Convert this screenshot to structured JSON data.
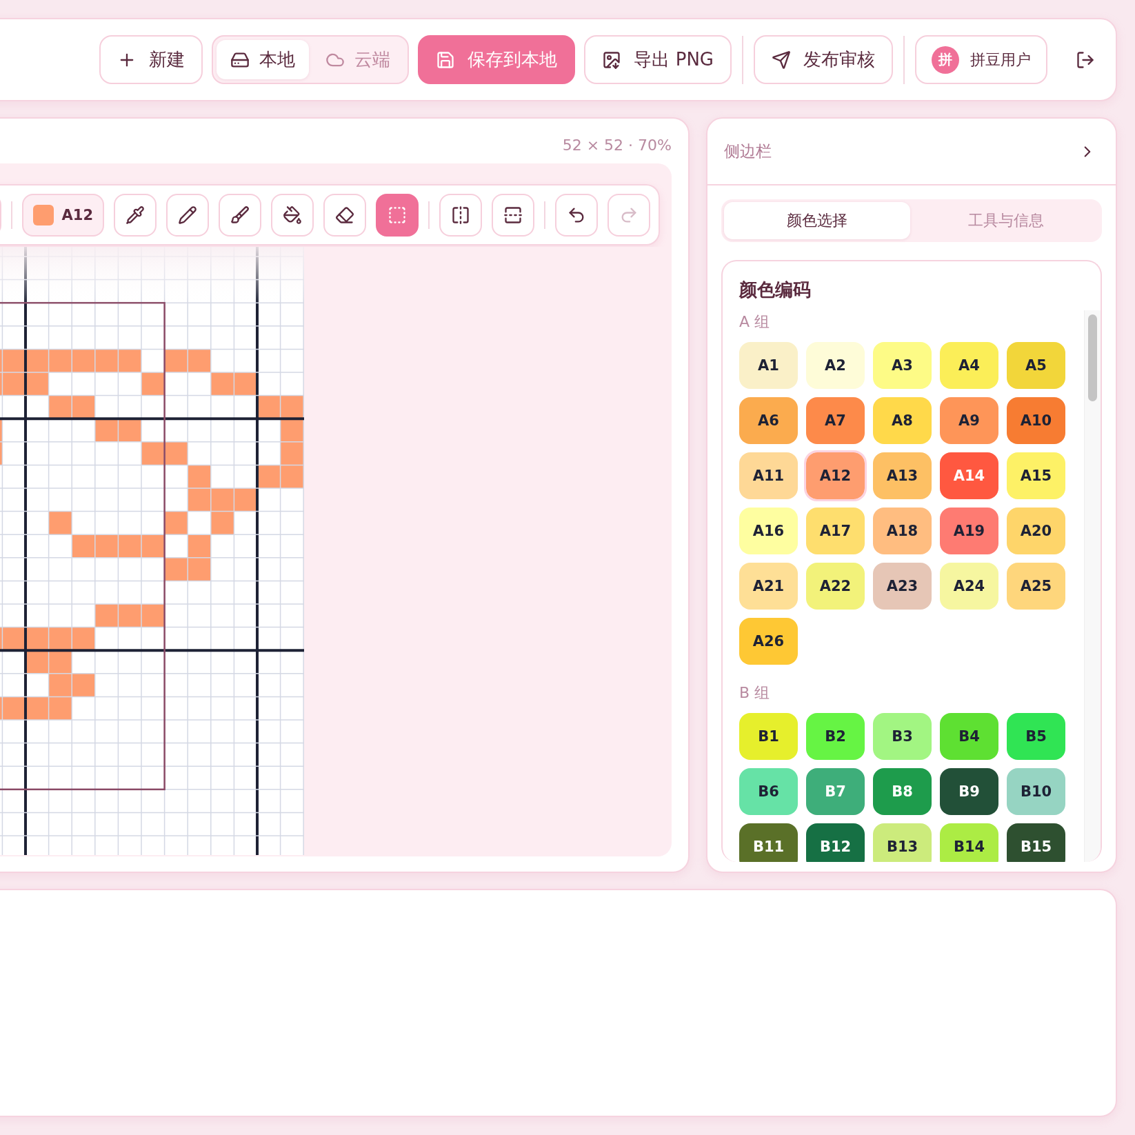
{
  "header": {
    "new_label": "新建",
    "storage": [
      {
        "kind": "local",
        "label": "本地",
        "selected": true
      },
      {
        "kind": "cloud",
        "label": "云端",
        "selected": false
      }
    ],
    "save_label": "保存到本地",
    "export_label": "导出 PNG",
    "publish_label": "发布审核",
    "user": {
      "avatar": "拼",
      "name": "拼豆用户"
    }
  },
  "canvas": {
    "size_label": "52 × 52 · 70%",
    "current_color": {
      "code": "A12",
      "color": "#fe9d6f"
    },
    "tools": [
      {
        "kind": "pipette",
        "selected": false
      },
      {
        "kind": "pencil",
        "selected": false
      },
      {
        "kind": "brush",
        "selected": false
      },
      {
        "kind": "bucket",
        "selected": false
      },
      {
        "kind": "eraser",
        "selected": false
      },
      {
        "kind": "select",
        "selected": true
      }
    ],
    "transforms": [
      {
        "kind": "flip_h"
      },
      {
        "kind": "flip_v"
      }
    ],
    "history": [
      {
        "kind": "undo",
        "disabled": false
      },
      {
        "kind": "redo",
        "disabled": true
      }
    ]
  },
  "sidebar": {
    "title": "侧边栏",
    "tabs": [
      {
        "label": "颜色选择",
        "selected": true
      },
      {
        "label": "工具与信息",
        "selected": false
      }
    ],
    "palette": {
      "title": "颜色编码",
      "groups": [
        {
          "label": "A 组",
          "swatches": [
            {
              "code": "A1",
              "color": "#faf0c8",
              "selected": false
            },
            {
              "code": "A2",
              "color": "#fefcd8",
              "selected": false
            },
            {
              "code": "A3",
              "color": "#fdfb86",
              "selected": false
            },
            {
              "code": "A4",
              "color": "#fbee58",
              "selected": false
            },
            {
              "code": "A5",
              "color": "#f2d63a",
              "selected": false
            },
            {
              "code": "A6",
              "color": "#fbab4e",
              "selected": false
            },
            {
              "code": "A7",
              "color": "#fd8a4a",
              "selected": false
            },
            {
              "code": "A8",
              "color": "#ffd94a",
              "selected": false
            },
            {
              "code": "A9",
              "color": "#fe9558",
              "selected": false
            },
            {
              "code": "A10",
              "color": "#f77c32",
              "selected": false
            },
            {
              "code": "A11",
              "color": "#fed896",
              "selected": false
            },
            {
              "code": "A12",
              "color": "#fe9d6f",
              "selected": true
            },
            {
              "code": "A13",
              "color": "#fdc064",
              "selected": false
            },
            {
              "code": "A14",
              "color": "#ff5840",
              "selected": false
            },
            {
              "code": "A15",
              "color": "#fdf166",
              "selected": false
            },
            {
              "code": "A16",
              "color": "#fefea0",
              "selected": false
            },
            {
              "code": "A17",
              "color": "#fede6e",
              "selected": false
            },
            {
              "code": "A18",
              "color": "#ffbd80",
              "selected": false
            },
            {
              "code": "A19",
              "color": "#fe7b72",
              "selected": false
            },
            {
              "code": "A20",
              "color": "#fed56a",
              "selected": false
            },
            {
              "code": "A21",
              "color": "#fedf96",
              "selected": false
            },
            {
              "code": "A22",
              "color": "#f2f27a",
              "selected": false
            },
            {
              "code": "A23",
              "color": "#e6c6b6",
              "selected": false
            },
            {
              "code": "A24",
              "color": "#f6f6a0",
              "selected": false
            },
            {
              "code": "A25",
              "color": "#fed67c",
              "selected": false
            },
            {
              "code": "A26",
              "color": "#fec834",
              "selected": false
            }
          ]
        },
        {
          "label": "B 组",
          "swatches": [
            {
              "code": "B1",
              "color": "#e6ef2c",
              "selected": false
            },
            {
              "code": "B2",
              "color": "#66f444",
              "selected": false
            },
            {
              "code": "B3",
              "color": "#a2f582",
              "selected": false
            },
            {
              "code": "B4",
              "color": "#5ee032",
              "selected": false
            },
            {
              "code": "B5",
              "color": "#30e454",
              "selected": false
            },
            {
              "code": "B6",
              "color": "#66e2a6",
              "selected": false
            },
            {
              "code": "B7",
              "color": "#3eae7a",
              "selected": false
            },
            {
              "code": "B8",
              "color": "#1e9c4c",
              "selected": false
            },
            {
              "code": "B9",
              "color": "#225038",
              "selected": false
            },
            {
              "code": "B10",
              "color": "#96d4c2",
              "selected": false
            },
            {
              "code": "B11",
              "color": "#5a7028",
              "selected": false
            },
            {
              "code": "B12",
              "color": "#167044",
              "selected": false
            },
            {
              "code": "B13",
              "color": "#cceb7c",
              "selected": false
            },
            {
              "code": "B14",
              "color": "#acec44",
              "selected": false
            },
            {
              "code": "B15",
              "color": "#2e5030",
              "selected": false
            }
          ]
        }
      ]
    }
  }
}
